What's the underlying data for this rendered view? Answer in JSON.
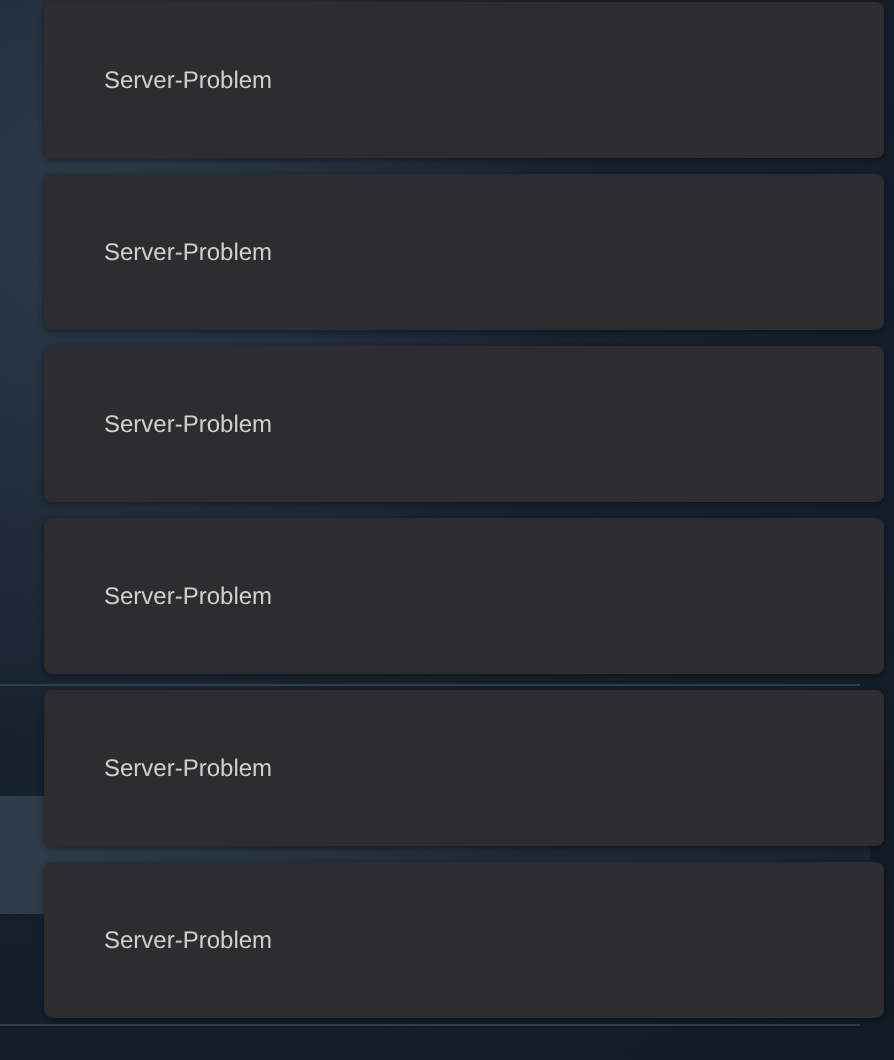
{
  "toasts": [
    {
      "message": "Server-Problem"
    },
    {
      "message": "Server-Problem"
    },
    {
      "message": "Server-Problem"
    },
    {
      "message": "Server-Problem"
    },
    {
      "message": "Server-Problem"
    },
    {
      "message": "Server-Problem"
    }
  ]
}
